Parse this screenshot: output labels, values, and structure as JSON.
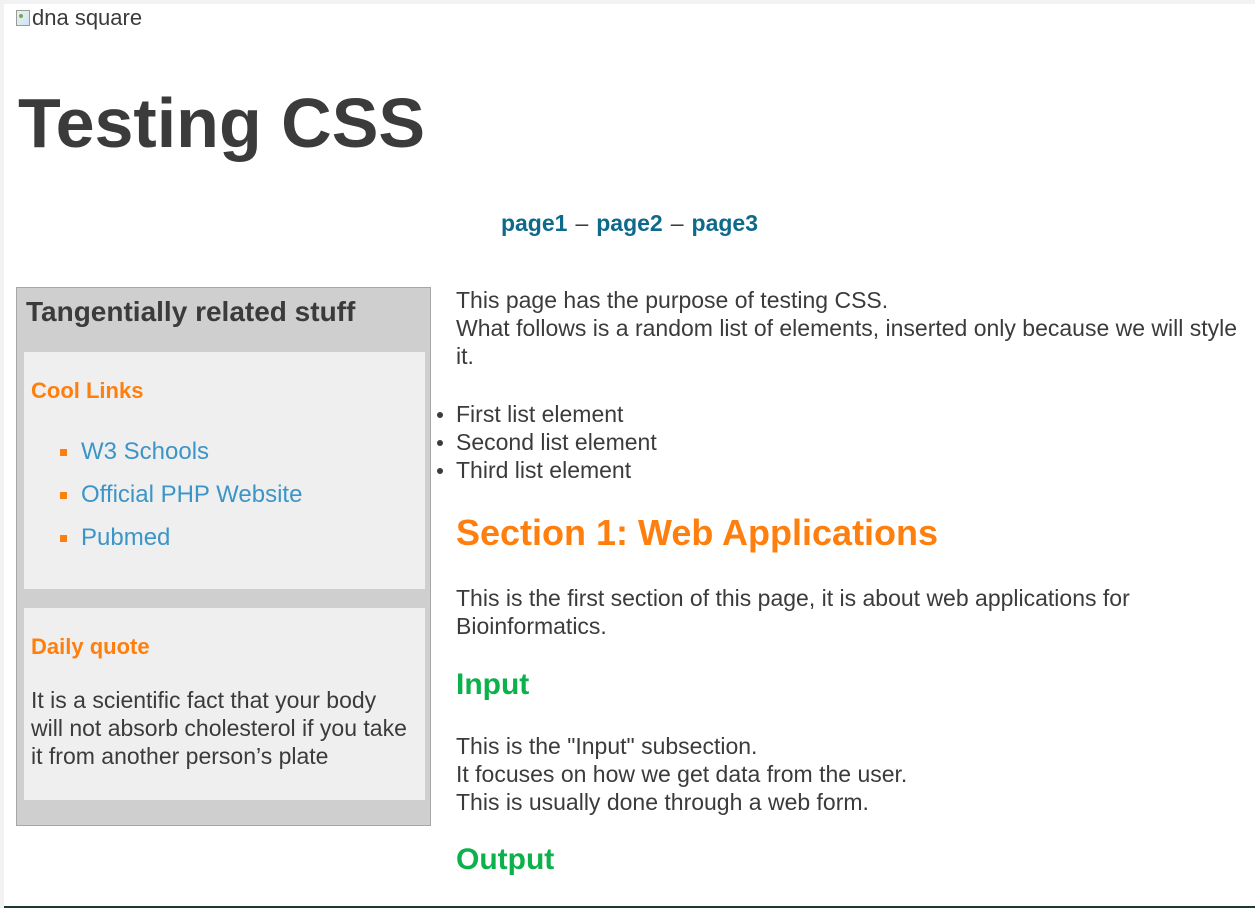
{
  "header": {
    "image_alt": "dna square",
    "title": "Testing CSS"
  },
  "nav": {
    "links": [
      "page1",
      "page2",
      "page3"
    ],
    "separator": "–"
  },
  "sidebar": {
    "heading": "Tangentially related stuff",
    "links_box": {
      "heading": "Cool Links",
      "items": [
        "W3 Schools",
        "Official PHP Website",
        "Pubmed"
      ]
    },
    "quote_box": {
      "heading": "Daily quote",
      "text": "It is a scientific fact that your body will not absorb cholesterol if you take it from another person’s plate"
    }
  },
  "main": {
    "intro_line1": "This page has the purpose of testing CSS.",
    "intro_line2": "What follows is a random list of elements, inserted only because we will style it.",
    "list": [
      "First list element",
      "Second list element",
      "Third list element"
    ],
    "section1": {
      "title": "Section 1: Web Applications",
      "text": "This is the first section of this page, it is about web applications for Bioinformatics."
    },
    "input": {
      "title": "Input",
      "line1": "This is the \"Input\" subsection.",
      "line2": "It focuses on how we get data from the user.",
      "line3": "This is usually done through a web form."
    },
    "output": {
      "title": "Output"
    }
  },
  "colors": {
    "accent_orange": "#ff7f0e",
    "subsection_green": "#0bb14a",
    "nav_link": "#0d6a8a",
    "sidebar_link": "#3c95c7"
  }
}
